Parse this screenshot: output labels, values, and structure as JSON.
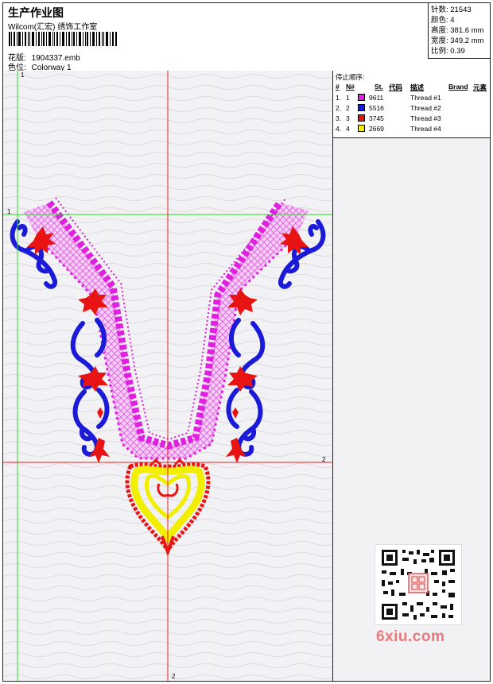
{
  "header": {
    "title": "生产作业图",
    "company": "Wilcom(汇宏) 绣饰工作室",
    "design_label": "花版:",
    "design_value": "1904337.emb",
    "colorway_label": "色位:",
    "colorway_value": "Colorway 1"
  },
  "stats": {
    "stitches": "针数: 21543",
    "colors": "颜色: 4",
    "height": "高度: 381.6 mm",
    "width": "宽度: 349.2 mm",
    "scale": "比例: 0.39"
  },
  "stop_sequence": {
    "title": "停止顺序:",
    "headers": [
      "#",
      "N#",
      "St.",
      "代码",
      "描述",
      "Brand",
      "元素"
    ],
    "rows": [
      {
        "num": "1.",
        "n": "1",
        "code": "9611",
        "desc": "Thread #1",
        "color": "#e020e0"
      },
      {
        "num": "2.",
        "n": "2",
        "code": "5516",
        "desc": "Thread #2",
        "color": "#1a1ad8"
      },
      {
        "num": "3.",
        "n": "3",
        "code": "3745",
        "desc": "Thread #3",
        "color": "#e81414"
      },
      {
        "num": "4.",
        "n": "4",
        "code": "2669",
        "desc": "Thread #4",
        "color": "#f2ee00"
      }
    ]
  },
  "guides": {
    "green_label_top": "1",
    "green_label_left": "1",
    "red_label_right": "2",
    "red_label_bottom": "2"
  },
  "watermark": {
    "site": "6xiu.com"
  },
  "colors": {
    "magenta": "#e020e0",
    "blue": "#1a1ad8",
    "red": "#e81414",
    "yellow": "#f2ee00",
    "guide_green": "#22dd22",
    "guide_red": "#dd2222"
  }
}
